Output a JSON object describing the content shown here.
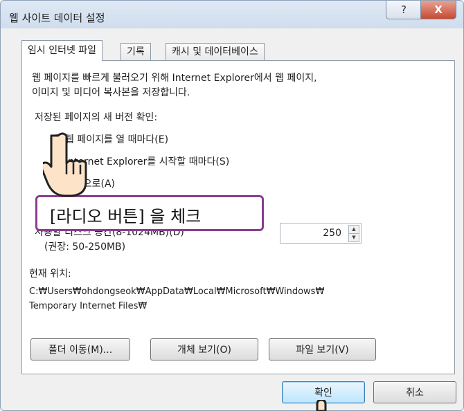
{
  "window": {
    "title": "웹 사이트 데이터 설정",
    "help_symbol": "?",
    "close_symbol": "X"
  },
  "tabs": [
    {
      "label": "임시 인터넷 파일"
    },
    {
      "label": "기록"
    },
    {
      "label": "캐시 및 데이터베이스"
    }
  ],
  "panel": {
    "description_line1": "웹 페이지를 빠르게 불러오기 위해 Internet Explorer에서 웹 페이지,",
    "description_line2": "이미지 및 미디어 복사본을 저장합니다.",
    "check_label": "저장된 페이지의 새 버전 확인:",
    "radios": [
      {
        "label": "웹 페이지를 열 때마다(E)",
        "checked": true
      },
      {
        "label": "Internet Explorer를 시작할 때마다(S)",
        "checked": false
      },
      {
        "label": "자동으로(A)",
        "checked": false
      }
    ],
    "disk_space_label": "사용할 디스크 공간(8-1024MB)(D)",
    "recommended": "(권장: 50-250MB)",
    "disk_space_value": "250",
    "current_location_label": "현재 위치:",
    "path_line1": "C:₩Users₩ohdongseok₩AppData₩Local₩Microsoft₩Windows₩",
    "path_line2": "Temporary Internet Files₩",
    "buttons": {
      "move_folder": "폴더 이동(M)...",
      "view_objects": "개체 보기(O)",
      "view_files": "파일 보기(V)"
    }
  },
  "footer": {
    "ok": "확인",
    "cancel": "취소"
  },
  "callout": {
    "text": "[라디오 버튼] 을 체크"
  },
  "icons": [
    "help-icon",
    "close-icon",
    "hand-pointer-icon"
  ],
  "colors": {
    "accent": "#2a6fc4",
    "callout_border": "#8a3e8f",
    "close": "#c44a33"
  }
}
